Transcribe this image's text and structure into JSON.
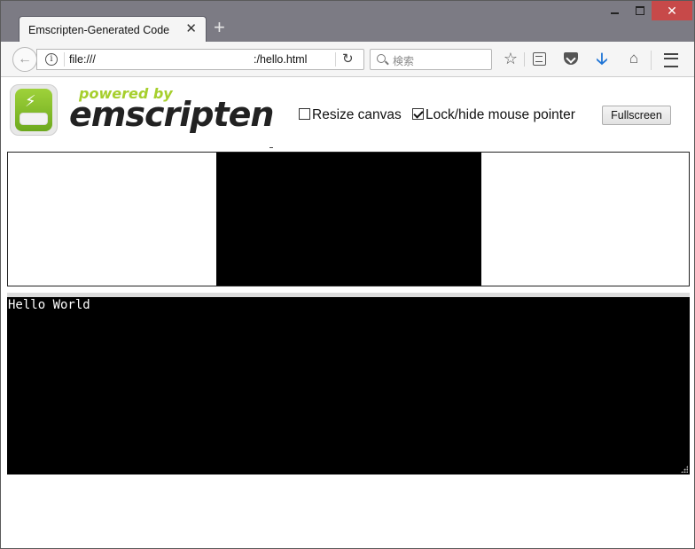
{
  "browser": {
    "tab_title": "Emscripten-Generated Code",
    "tab_close": "✕",
    "new_tab": "+",
    "url_prefix": "file:///",
    "url_suffix": ":/hello.html",
    "search_placeholder": "検索",
    "window_close": "✕"
  },
  "page": {
    "logo": {
      "powered_by": "powered by",
      "name": "emscripten"
    },
    "options": {
      "resize_canvas": {
        "label": "Resize canvas",
        "checked": false
      },
      "lock_pointer": {
        "label": "Lock/hide mouse pointer",
        "checked": true
      }
    },
    "fullscreen_label": "Fullscreen",
    "output_text": "Hello World"
  }
}
